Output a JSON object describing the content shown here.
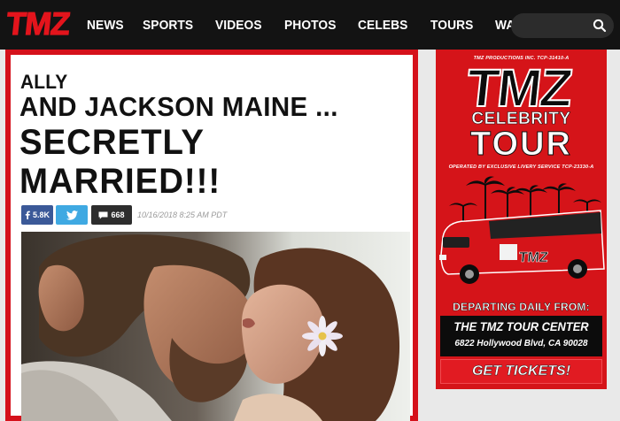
{
  "header": {
    "logo_text": "TMZ",
    "nav": [
      "NEWS",
      "SPORTS",
      "VIDEOS",
      "PHOTOS",
      "CELEBS",
      "TOURS",
      "WATCH TMZ"
    ],
    "search_placeholder": ""
  },
  "article": {
    "kicker": "ALLY",
    "headline_line1": "AND JACKSON MAINE ...",
    "headline_line2": "SECRETLY",
    "headline_line3": "MARRIED!!!",
    "facebook_count": "5.8K",
    "comment_count": "668",
    "datestamp": "10/16/2018 8:25 AM PDT"
  },
  "ad": {
    "fine_print": "TMZ PRODUCTIONS INC. TCP-31410-A",
    "logo_text": "TMZ",
    "line1": "CELEBRITY",
    "line2": "TOUR",
    "operated_by": "OPERATED BY EXCLUSIVE LIVERY SERVICE TCP-23330-A",
    "departing": "DEPARTING DAILY FROM:",
    "center": "THE TMZ TOUR CENTER",
    "address": "6822 Hollywood Blvd, CA 90028",
    "cta": "GET TICKETS!"
  },
  "colors": {
    "brand_red": "#d5111b",
    "nav_bg": "#131313",
    "facebook": "#3b5998",
    "twitter": "#3fa9e2"
  },
  "icons": {
    "facebook": "facebook-icon",
    "twitter": "twitter-icon",
    "comment": "comment-icon",
    "search": "search-icon"
  }
}
